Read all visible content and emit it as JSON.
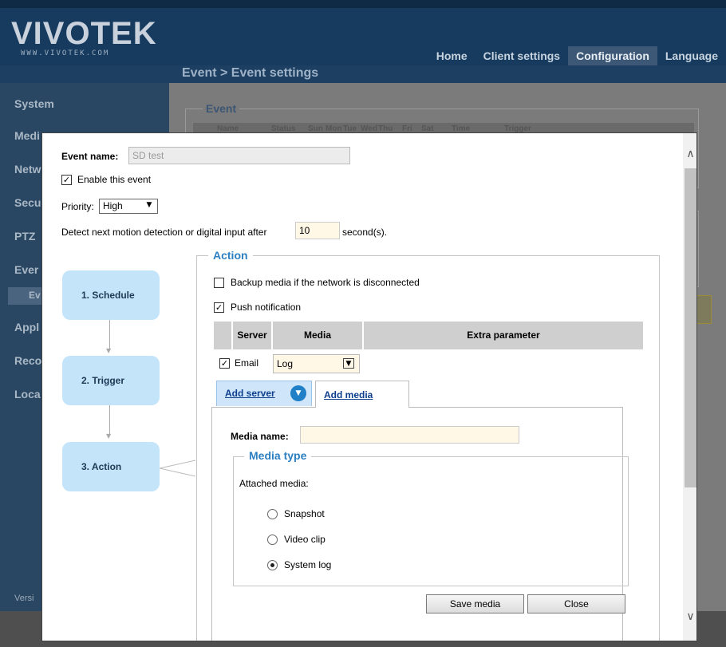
{
  "app": {
    "logo_text": "VIVOTEK",
    "logo_url": "WWW.VIVOTEK.COM",
    "nav": [
      "Home",
      "Client settings",
      "Configuration",
      "Language"
    ],
    "breadcrumb": "Event > Event settings",
    "sidebar": [
      "System",
      "Medi",
      "Netw",
      "Secu",
      "PTZ",
      "Ever",
      "Ev",
      "Appl",
      "Reco",
      "Loca"
    ],
    "version": "Versi",
    "bg_panel_title": "Event",
    "bg_table_headers": [
      "Name",
      "Status",
      "Sun",
      "Mon",
      "Tue",
      "Wed",
      "Thu",
      "Fri",
      "Sat",
      "Time",
      "Trigger"
    ]
  },
  "dialog": {
    "event_name_label": "Event name:",
    "event_name_value": "SD test",
    "enable_label": "Enable this event",
    "enable_check": "✓",
    "priority_label": "Priority:",
    "priority_value": "High",
    "detect_label": "Detect next motion detection or digital input after",
    "detect_value": "10",
    "detect_unit": "second(s).",
    "steps": [
      "1.  Schedule",
      "2.  Trigger",
      "3.  Action"
    ],
    "action": {
      "legend": "Action",
      "backup_label": "Backup media if the network is disconnected",
      "push_label": "Push notification",
      "push_check": "✓",
      "table_headers": [
        "Server",
        "Media",
        "Extra parameter"
      ],
      "email_label": "Email",
      "email_check": "✓",
      "email_media": "Log",
      "tab_add_server": "Add server",
      "tab_add_media": "Add media",
      "media_name_label": "Media name:",
      "media_name_value": "",
      "media_type_legend": "Media type",
      "attached_label": "Attached media:",
      "options": [
        "Snapshot",
        "Video clip",
        "System log"
      ],
      "selected": "System log",
      "save_button": "Save media",
      "close_button": "Close"
    }
  },
  "icons": {
    "scroll_up": "∧",
    "scroll_down": "∨",
    "dropdown": "▼",
    "circle_down": "▼",
    "arrow_down": "▼"
  },
  "colors": {
    "accent_blue": "#2c7fc1",
    "step_bg": "#c4e4fa",
    "link": "#0e3f8d"
  }
}
